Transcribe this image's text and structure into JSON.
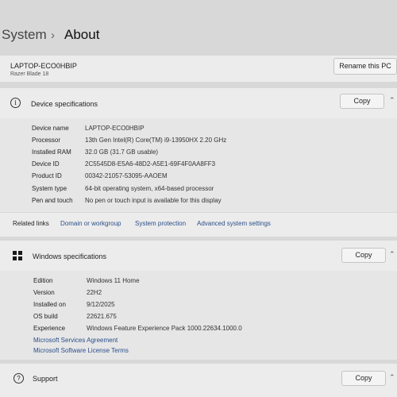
{
  "breadcrumb": {
    "root": "System",
    "separator": "›",
    "current": "About"
  },
  "pc": {
    "name": "LAPTOP-ECO0HBIP",
    "model": "Razer Blade 18",
    "rename_label": "Rename this PC"
  },
  "device_specs": {
    "title": "Device specifications",
    "copy_label": "Copy",
    "rows": [
      {
        "label": "Device name",
        "value": "LAPTOP-ECO0HBIP"
      },
      {
        "label": "Processor",
        "value": "13th Gen Intel(R) Core(TM) i9-13950HX   2.20 GHz"
      },
      {
        "label": "Installed RAM",
        "value": "32.0 GB (31.7 GB usable)"
      },
      {
        "label": "Device ID",
        "value": "2C5545D8-E5A6-48D2-A5E1-69F4F0AA8FF3"
      },
      {
        "label": "Product ID",
        "value": "00342-21057-53095-AAOEM"
      },
      {
        "label": "System type",
        "value": "64-bit operating system, x64-based processor"
      },
      {
        "label": "Pen and touch",
        "value": "No pen or touch input is available for this display"
      }
    ]
  },
  "related": {
    "label": "Related links",
    "links": [
      "Domain or workgroup",
      "System protection",
      "Advanced system settings"
    ]
  },
  "windows_specs": {
    "title": "Windows specifications",
    "copy_label": "Copy",
    "rows": [
      {
        "label": "Edition",
        "value": "Windows 11 Home"
      },
      {
        "label": "Version",
        "value": "22H2"
      },
      {
        "label": "Installed on",
        "value": "9/12/2025"
      },
      {
        "label": "OS build",
        "value": "22621.675"
      },
      {
        "label": "Experience",
        "value": "Windows Feature Experience Pack 1000.22634.1000.0"
      }
    ],
    "links": [
      "Microsoft Services Agreement",
      "Microsoft Software License Terms"
    ]
  },
  "support": {
    "title": "Support",
    "copy_label": "Copy"
  },
  "icons": {
    "chevron": "chevron-up-icon",
    "info": "info-icon",
    "windows": "windows-logo-icon",
    "support": "help-icon"
  }
}
